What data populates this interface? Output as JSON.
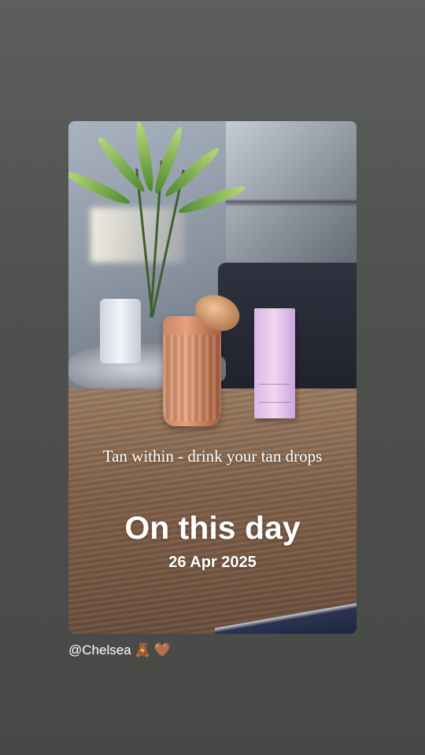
{
  "story": {
    "caption": "Tan within - drink your tan drops",
    "memory_title": "On this day",
    "memory_date": "26 Apr 2025",
    "product_label": "tan drops"
  },
  "mention": {
    "username": "@Chelsea",
    "emoji_1": "🧸",
    "emoji_2": "🤎"
  },
  "colors": {
    "background": "#525452",
    "text": "#ffffff"
  }
}
